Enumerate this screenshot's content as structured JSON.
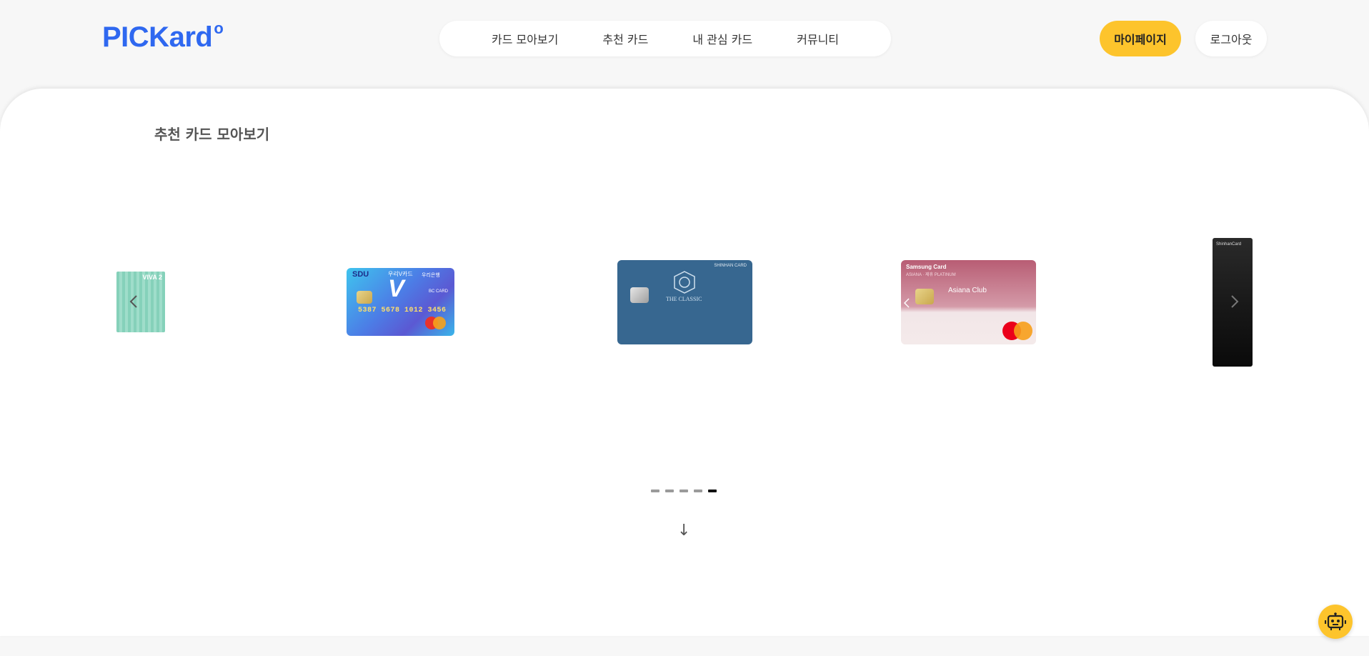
{
  "header": {
    "logo": "PICKard",
    "logo_mark": "o",
    "nav": [
      {
        "label": "카드 모아보기"
      },
      {
        "label": "추천 카드"
      },
      {
        "label": "내 관심 카드"
      },
      {
        "label": "커뮤니티"
      }
    ],
    "mypage_label": "마이페이지",
    "logout_label": "로그아웃"
  },
  "main": {
    "title": "추천 카드 모아보기",
    "carousel": {
      "prev_icon": "chevron-left-icon",
      "next_icon": "chevron-right-icon",
      "slide_count": 5,
      "active_index": 4,
      "cards": [
        {
          "brand": "VIVA 2"
        },
        {
          "brand": "SDU",
          "name": "우리V카드",
          "bank": "우리은행",
          "number": "5387 5678 1012 3456",
          "network": "BC CARD"
        },
        {
          "brand": "SHINHAN CARD",
          "name": "THE CLASSIC"
        },
        {
          "brand": "Samsung Card",
          "name": "Asiana Club",
          "tier": "ASIANA · 제휴 PLATINUM"
        },
        {
          "brand": "ShinhanCard"
        }
      ]
    },
    "scroll_hint_icon": "arrow-down-icon"
  },
  "chatbot_icon": "robot-icon",
  "colors": {
    "brand_blue": "#2f68f0",
    "accent_yellow": "#fdc42c"
  }
}
